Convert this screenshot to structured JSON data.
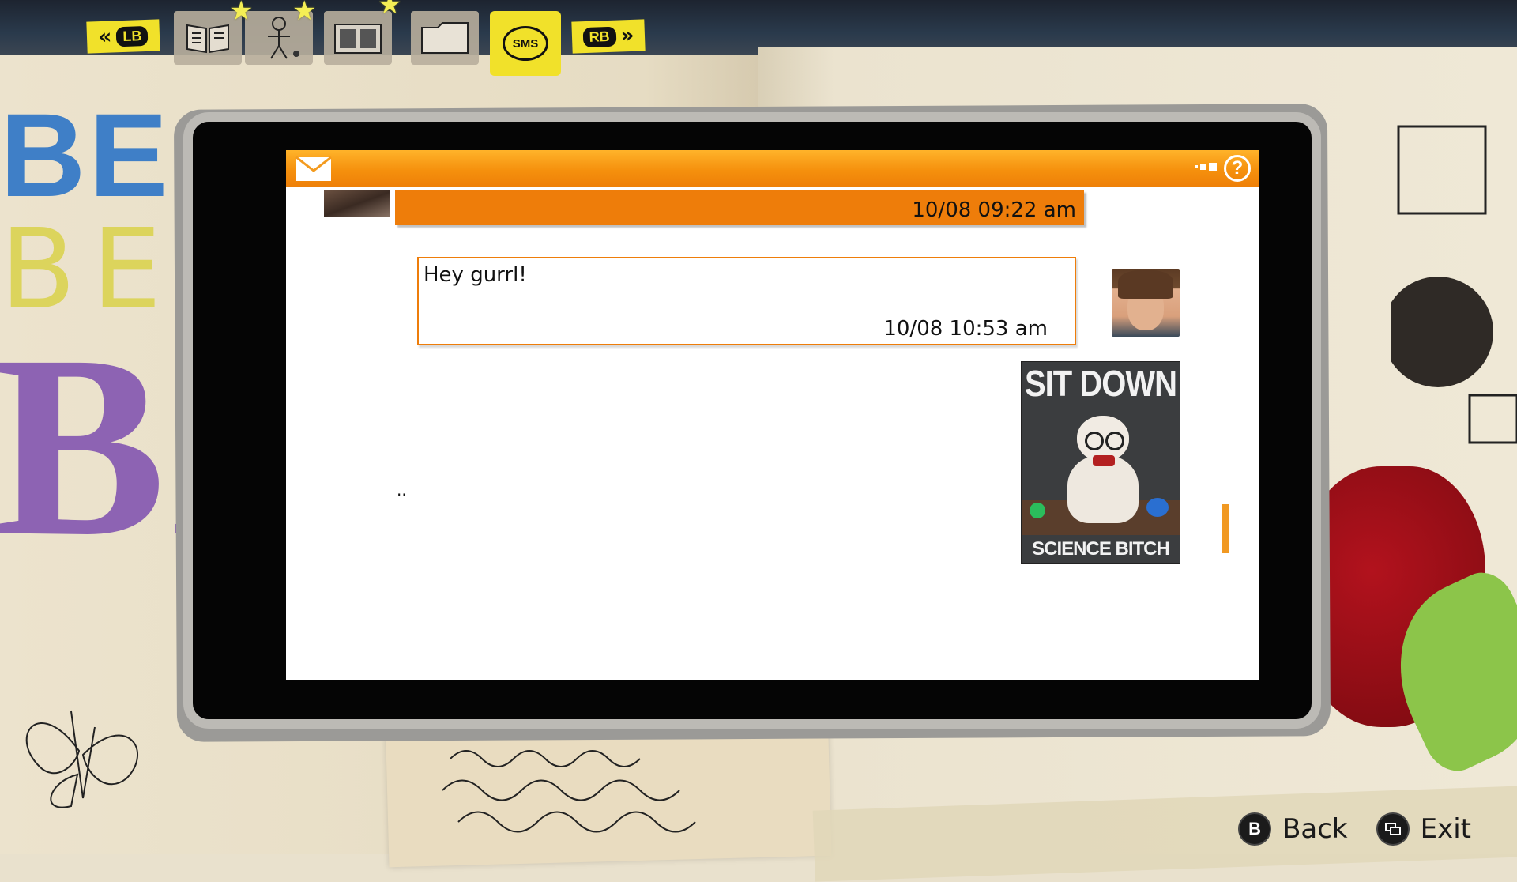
{
  "tabs": {
    "lb_label": "LB",
    "rb_label": "RB",
    "sms_label": "SMS",
    "items": [
      "journal-tab",
      "characters-tab",
      "photos-tab",
      "documents-tab",
      "sms-tab"
    ],
    "active": "sms-tab"
  },
  "background": {
    "collage_line1": "BE",
    "collage_line2": "BE",
    "collage_line3": "BI"
  },
  "phone": {
    "messages": [
      {
        "sender": "other",
        "text": "",
        "timestamp": "10/08  09:22 am"
      },
      {
        "sender": "max",
        "text": "Hey gurrl!",
        "timestamp": "10/08  10:53 am"
      },
      {
        "sender": "max",
        "image_title": "SIT DOWN",
        "image_caption": "SCIENCE BITCH"
      }
    ],
    "typing_indicator": ".."
  },
  "prompts": {
    "back_button": "B",
    "back_label": "Back",
    "exit_label": "Exit"
  },
  "colors": {
    "accent_orange": "#ee7d0a",
    "tab_yellow": "#f1e12a"
  }
}
